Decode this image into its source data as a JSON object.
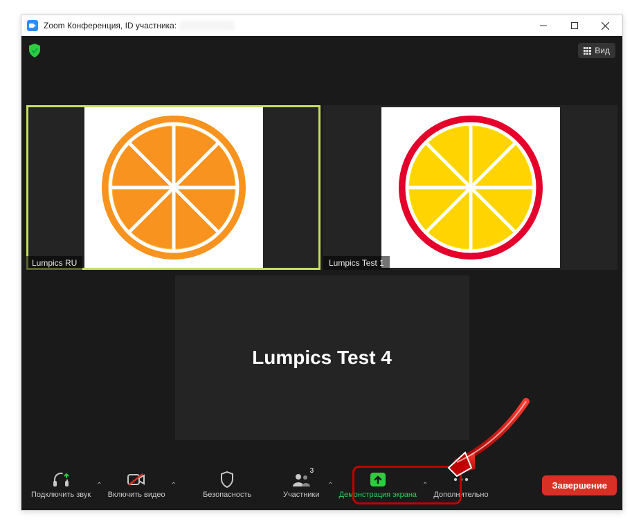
{
  "window": {
    "title": "Zoom Конференция, ID участника:"
  },
  "topbar": {
    "view_label": "Вид"
  },
  "participants": [
    {
      "name": "Lumpics RU",
      "active": true,
      "avatar": "orange"
    },
    {
      "name": "Lumpics Test 1",
      "active": false,
      "avatar": "lemon"
    },
    {
      "name": "Lumpics Test 4",
      "active": false,
      "avatar": "none"
    }
  ],
  "toolbar": {
    "audio": "Подключить звук",
    "video": "Включить видео",
    "security": "Безопасность",
    "participants": "Участники",
    "participants_count": "3",
    "share": "Демонстрация экрана",
    "more": "Дополнительно",
    "end": "Завершение"
  },
  "colors": {
    "accent_green": "#23d160",
    "active_border": "#c5de5f",
    "end_red": "#d93025",
    "annotation_red": "#c00000"
  }
}
